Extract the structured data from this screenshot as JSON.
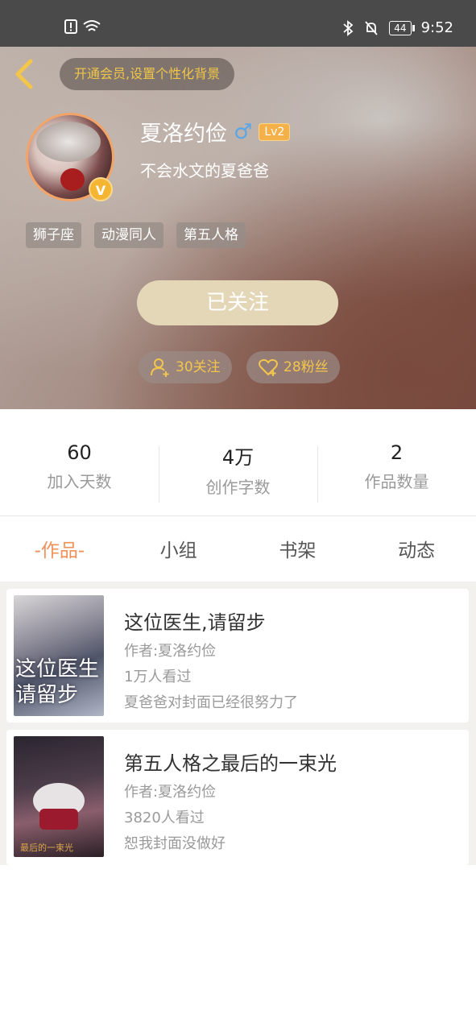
{
  "status_bar": {
    "time": "9:52",
    "battery": "44"
  },
  "header": {
    "vip_prompt": "开通会员,设置个性化背景",
    "user": {
      "name": "夏洛约俭",
      "gender_icon": "male-icon",
      "level": "Lv2",
      "vip_mark": "V",
      "signature": "不会水文的夏爸爸"
    },
    "tags": [
      "狮子座",
      "动漫同人",
      "第五人格"
    ],
    "follow_button": "已关注",
    "following": "30关注",
    "fans": "28粉丝",
    "accent_color": "#f2c64c"
  },
  "stats": [
    {
      "value": "60",
      "label": "加入天数"
    },
    {
      "value": "4万",
      "label": "创作字数"
    },
    {
      "value": "2",
      "label": "作品数量"
    }
  ],
  "tabs": [
    {
      "label": "-作品-",
      "active": true
    },
    {
      "label": "小组",
      "active": false
    },
    {
      "label": "书架",
      "active": false
    },
    {
      "label": "动态",
      "active": false
    }
  ],
  "works": [
    {
      "cover_text": "这位医生请留步",
      "title": "这位医生,请留步",
      "author": "作者:夏洛约俭",
      "views": "1万人看过",
      "note": "夏爸爸对封面已经很努力了"
    },
    {
      "cover_text": "最后的一束光",
      "title": "第五人格之最后的一束光",
      "author": "作者:夏洛约俭",
      "views": "3820人看过",
      "note": "恕我封面没做好"
    }
  ]
}
